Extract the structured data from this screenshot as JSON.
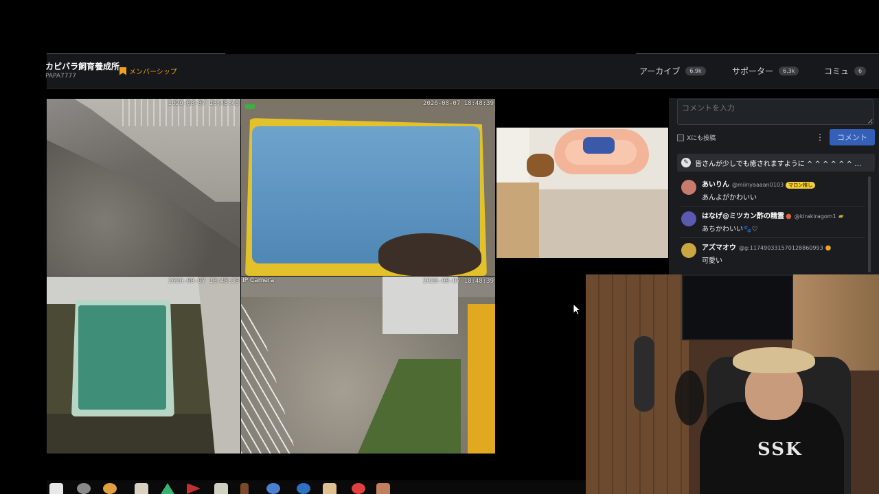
{
  "header": {
    "channel_name": "カピバラ飼育養成所",
    "channel_id": "PAPA7777",
    "membership_label": "メンバーシップ",
    "nav": [
      {
        "label": "アーカイブ",
        "count": "6.9k"
      },
      {
        "label": "サポーター",
        "count": "6.3k"
      },
      {
        "label": "コミュ",
        "count": "6"
      }
    ]
  },
  "cameras": {
    "tl_timestamp": "2026-08-07 18:48:40",
    "tm_timestamp": "2026-08-07 18:48:39",
    "bl_timestamp": "2026-08-07 18:48:39",
    "bm_label": "IP Camera",
    "bm_timestamp": "2026-08-07 18:48:39"
  },
  "chat": {
    "input_placeholder": "コメントを入力",
    "x_post_label": "Xにも投稿",
    "more_icon": "⋮",
    "submit_label": "コメント",
    "pinned": "皆さんが少しでも癒されますように ^ ^ ^ ^ ^ ^ …",
    "messages": [
      {
        "name": "あいりん",
        "handle": "@miinyaaaan0103",
        "badge": "マロン推し",
        "text": "あんよがかわいい",
        "avatar_color": "#c87b6a"
      },
      {
        "name": "はなげ@ミツカン酢の精霊",
        "handle": "@kirakiragom1",
        "badge": "",
        "text": "あちかわいい🐾♡",
        "avatar_color": "#5a5ab0"
      },
      {
        "name": "アズマオウ",
        "handle": "@g:117490331570128860993",
        "badge": "",
        "text": "可愛い",
        "avatar_color": "#c9a640"
      }
    ]
  },
  "webcam": {
    "shirt_text": "SSK"
  },
  "colors": {
    "accent_orange": "#f0a020",
    "button_blue": "#3460b8",
    "header_bg": "#16181b"
  }
}
